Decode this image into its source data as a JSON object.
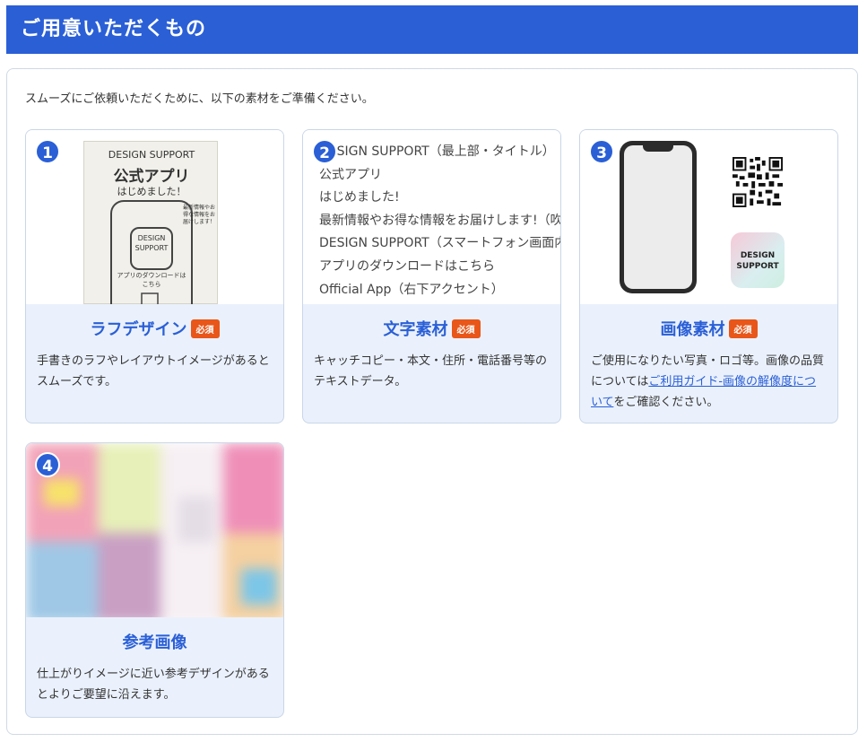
{
  "header": {
    "title": "ご用意いただくもの"
  },
  "intro": "スムーズにご依頼いただくために、以下の素材をご準備ください。",
  "required_label": "必須",
  "cards": [
    {
      "number": "1",
      "title": "ラフデザイン",
      "desc": "手書きのラフやレイアウトイメージがあるとスムーズです。",
      "sketch": {
        "line1": "DESIGN SUPPORT",
        "line2": "公式アプリ",
        "line3": "はじめました！",
        "side": "最新情報やお得な情報をお届けします！",
        "logo": "DESIGN SUPPORT",
        "dl": "アプリのダウンロードはこちら"
      }
    },
    {
      "number": "2",
      "title": "文字素材",
      "desc": "キャッチコピー・本文・住所・電話番号等のテキストデータ。",
      "lines": [
        "DESIGN SUPPORT（最上部・タイトル）",
        "公式アプリ",
        "はじめました!",
        "最新情報やお得な情報をお届けします!（吹き",
        "DESIGN SUPPORT（スマートフォン画面内",
        "アプリのダウンロードはこちら",
        "Official App（右下アクセント）"
      ]
    },
    {
      "number": "3",
      "title": "画像素材",
      "desc_pre": "ご使用になりたい写真・ロゴ等。画像の品質については",
      "desc_link": "ご利用ガイド-画像の解像度について",
      "desc_post": "をご確認ください。",
      "logo_text": "DESIGN SUPPORT"
    },
    {
      "number": "4",
      "title": "参考画像",
      "desc": "仕上がりイメージに近い参考デザインがあるとよりご要望に沿えます。"
    }
  ]
}
